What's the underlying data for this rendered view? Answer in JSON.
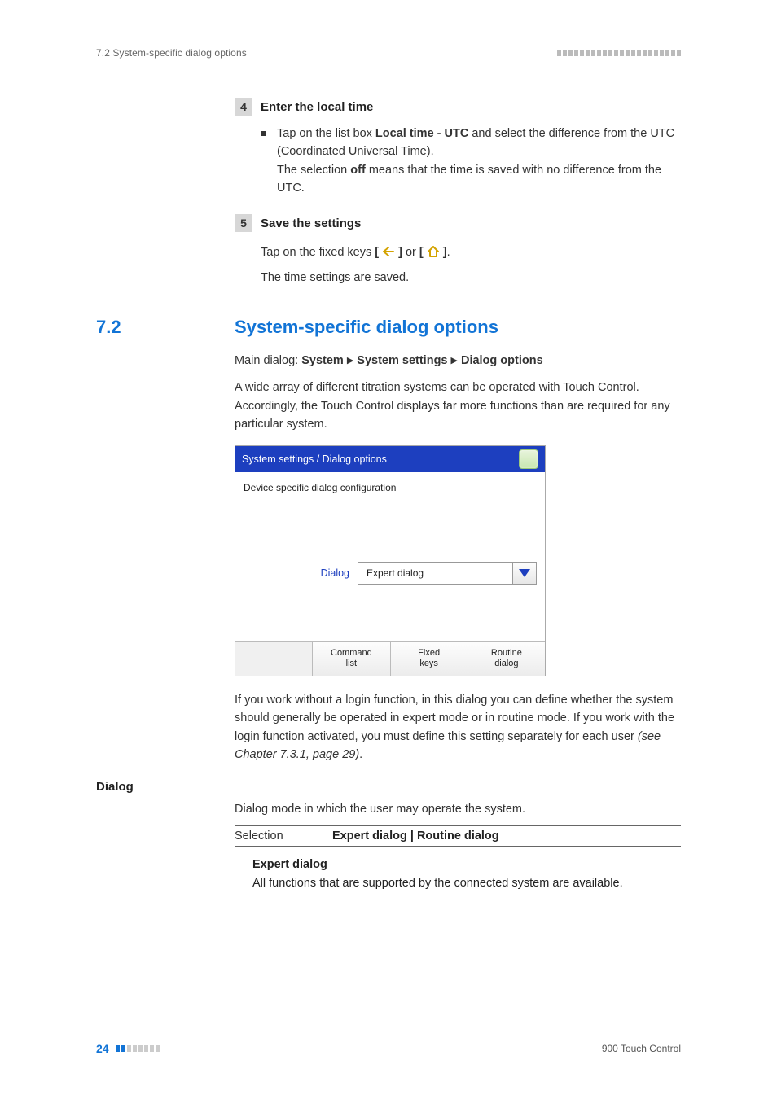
{
  "header": {
    "section_ref": "7.2 System-specific dialog options"
  },
  "step4": {
    "num": "4",
    "title": "Enter the local time",
    "bullet_pre": "Tap on the list box ",
    "bullet_bold": "Local time - UTC",
    "bullet_post": " and select the difference from the UTC (Coordinated Universal Time).",
    "line2_pre": "The selection ",
    "line2_bold": "off",
    "line2_post": " means that the time is saved with no difference from the UTC."
  },
  "step5": {
    "num": "5",
    "title": "Save the settings",
    "line1_pre": "Tap on the fixed keys ",
    "line1_mid": " or ",
    "line1_post": ".",
    "line2": "The time settings are saved."
  },
  "heading": {
    "num": "7.2",
    "title": "System-specific dialog options"
  },
  "breadcrumb": {
    "prefix": "Main dialog: ",
    "p1": "System",
    "p2": "System settings",
    "p3": "Dialog options"
  },
  "intro": "A wide array of different titration systems can be operated with Touch Control. Accordingly, the Touch Control displays far more functions than are required for any particular system.",
  "screenshot": {
    "titlebar": "System settings / Dialog options",
    "subtitle": "Device specific dialog configuration",
    "field_label": "Dialog",
    "field_value": "Expert dialog",
    "btn1": "Command\nlist",
    "btn2": "Fixed\nkeys",
    "btn3": "Routine\ndialog"
  },
  "after_ss_pre": "If you work without a login function, in this dialog you can define whether the system should generally be operated in expert mode or in routine mode. If you work with the login function activated, you must define this setting separately for each user ",
  "after_ss_italic": "(see Chapter 7.3.1, page 29)",
  "after_ss_post": ".",
  "dialog_section": {
    "sidehead": "Dialog",
    "intro": "Dialog mode in which the user may operate the system.",
    "sel_label": "Selection",
    "sel_value": "Expert dialog | Routine dialog",
    "sub_head": "Expert dialog",
    "sub_body": "All functions that are supported by the connected system are available."
  },
  "footer": {
    "pagenum": "24",
    "product": "900 Touch Control"
  }
}
